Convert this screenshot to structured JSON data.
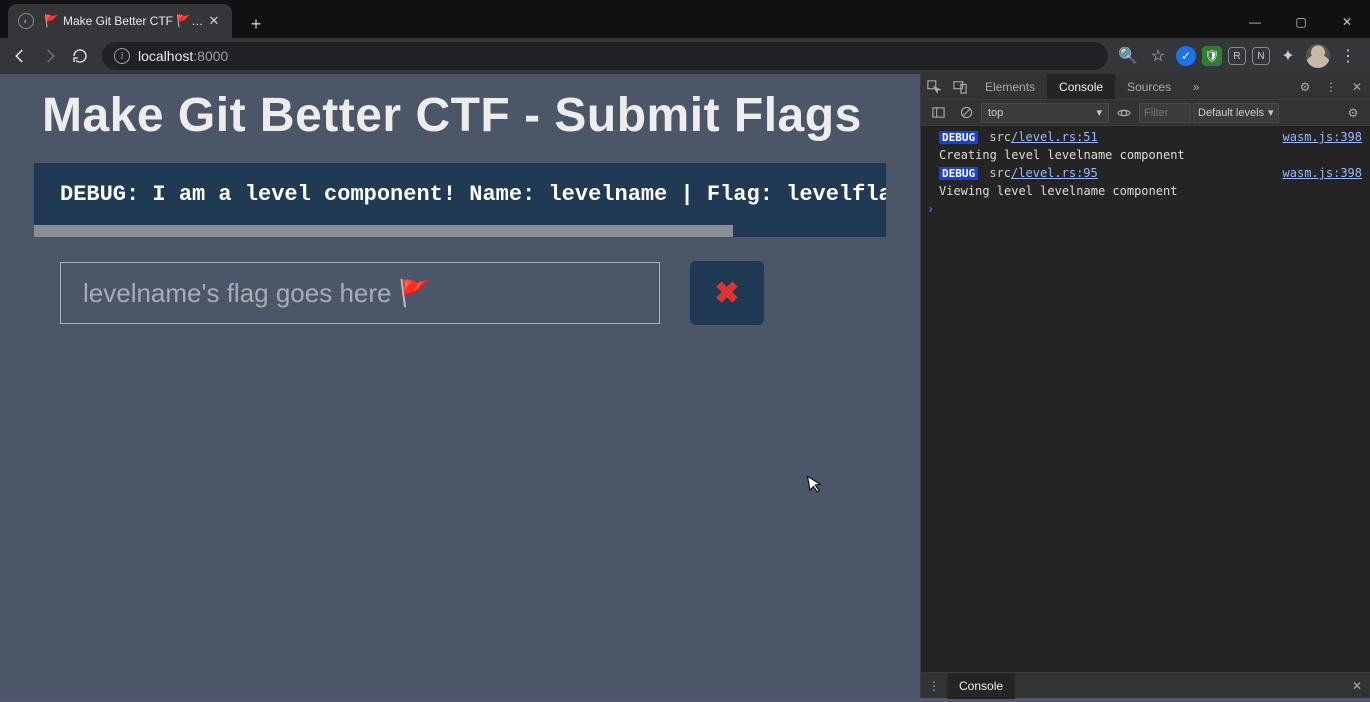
{
  "browser": {
    "tab_title": "Make Git Better CTF 🚩 Subm",
    "url_host": "localhost",
    "url_port": ":8000",
    "window_controls": {
      "minimize": "—",
      "maximize": "▢",
      "close": "✕"
    },
    "nav": {
      "back": "←",
      "forward": "→",
      "reload": "⟳"
    },
    "toolbar_icons": [
      "search-icon",
      "star-icon",
      "ext-blue",
      "ext-green",
      "ext-box",
      "ext-n",
      "puzzle-icon",
      "avatar",
      "menu-icon"
    ]
  },
  "page": {
    "heading": "Make Git Better CTF - Submit Flags",
    "debug_line": "DEBUG: I am a level component! Name: levelname | Flag: levelflag | Sta",
    "flag_placeholder": "levelname's flag goes here 🚩",
    "submit_icon": "✖",
    "scrollbar_thumb_pct": 82
  },
  "devtools": {
    "tabs": [
      "Elements",
      "Console",
      "Sources"
    ],
    "active_tab": "Console",
    "more_tabs_icon": "»",
    "settings_icon": "⚙",
    "menu_icon": "⋮",
    "close_icon": "✕",
    "toolbar": {
      "context": "top",
      "filter_placeholder": "Filter",
      "levels": "Default levels"
    },
    "logs": [
      {
        "badge": "DEBUG",
        "src_prefix": "src",
        "src_file": "/level.rs:51",
        "link": "wasm.js:398",
        "msg": "Creating level levelname component"
      },
      {
        "badge": "DEBUG",
        "src_prefix": "src",
        "src_file": "/level.rs:95",
        "link": "wasm.js:398",
        "msg": "Viewing level levelname component"
      }
    ],
    "drawer_label": "Console"
  }
}
